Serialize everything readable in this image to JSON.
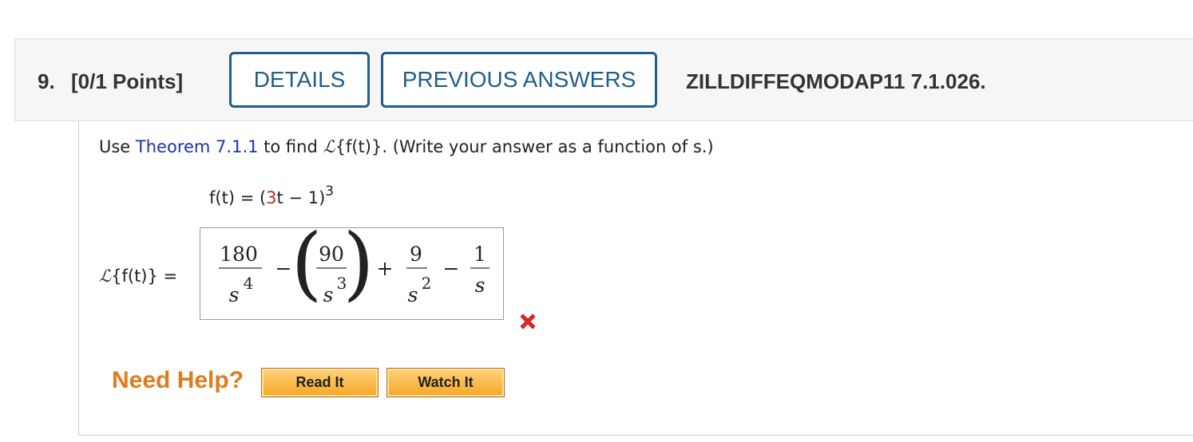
{
  "header": {
    "number": "9.",
    "points": "[0/1 Points]",
    "details_label": "DETAILS",
    "previous_answers_label": "PREVIOUS ANSWERS",
    "question_id": "ZILLDIFFEQMODAP11 7.1.026."
  },
  "prompt": {
    "use": "Use",
    "theorem_link": "Theorem 7.1.1",
    "to_find": "to find",
    "laplace": "ℒ",
    "f_of_t": "{f(t)}.",
    "instruction": "(Write your answer as a function of s.)"
  },
  "function_line": {
    "lhs": "f(t) = (",
    "coef": "3",
    "rest": "t − 1)",
    "exponent": "3"
  },
  "answer": {
    "lhs_symbol": "ℒ",
    "lhs_rest": "{f(t)} =",
    "term1_num": "180",
    "term1_den_base": "s",
    "term1_den_exp": "4",
    "op1": "−",
    "term2_num": "90",
    "term2_den_base": "s",
    "term2_den_exp": "3",
    "op2": "+",
    "term3_num": "9",
    "term3_den_base": "s",
    "term3_den_exp": "2",
    "op3": "−",
    "term4_num": "1",
    "term4_den_base": "s",
    "status": "incorrect",
    "status_color": "#e0252a"
  },
  "help": {
    "label": "Need Help?",
    "read_it": "Read It",
    "watch_it": "Watch It"
  }
}
